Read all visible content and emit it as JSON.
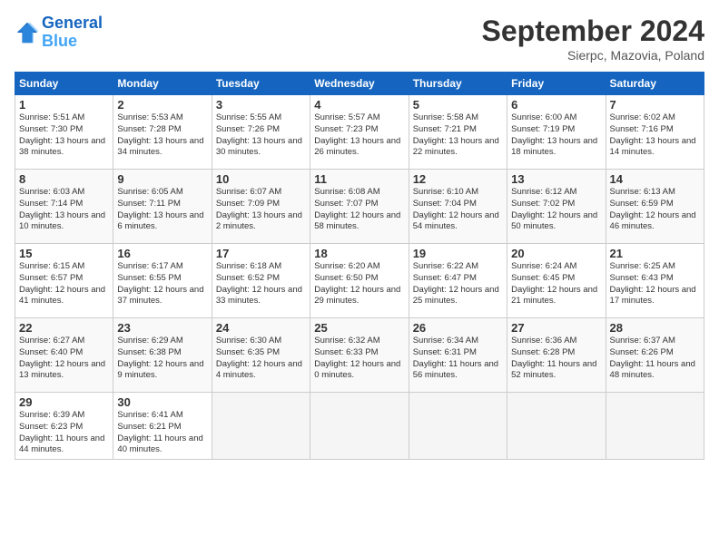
{
  "header": {
    "logo_line1": "General",
    "logo_line2": "Blue",
    "month_title": "September 2024",
    "location": "Sierpc, Mazovia, Poland"
  },
  "days_of_week": [
    "Sunday",
    "Monday",
    "Tuesday",
    "Wednesday",
    "Thursday",
    "Friday",
    "Saturday"
  ],
  "weeks": [
    [
      {
        "day": "1",
        "sunrise": "5:51 AM",
        "sunset": "7:30 PM",
        "daylight": "13 hours and 38 minutes."
      },
      {
        "day": "2",
        "sunrise": "5:53 AM",
        "sunset": "7:28 PM",
        "daylight": "13 hours and 34 minutes."
      },
      {
        "day": "3",
        "sunrise": "5:55 AM",
        "sunset": "7:26 PM",
        "daylight": "13 hours and 30 minutes."
      },
      {
        "day": "4",
        "sunrise": "5:57 AM",
        "sunset": "7:23 PM",
        "daylight": "13 hours and 26 minutes."
      },
      {
        "day": "5",
        "sunrise": "5:58 AM",
        "sunset": "7:21 PM",
        "daylight": "13 hours and 22 minutes."
      },
      {
        "day": "6",
        "sunrise": "6:00 AM",
        "sunset": "7:19 PM",
        "daylight": "13 hours and 18 minutes."
      },
      {
        "day": "7",
        "sunrise": "6:02 AM",
        "sunset": "7:16 PM",
        "daylight": "13 hours and 14 minutes."
      }
    ],
    [
      {
        "day": "8",
        "sunrise": "6:03 AM",
        "sunset": "7:14 PM",
        "daylight": "13 hours and 10 minutes."
      },
      {
        "day": "9",
        "sunrise": "6:05 AM",
        "sunset": "7:11 PM",
        "daylight": "13 hours and 6 minutes."
      },
      {
        "day": "10",
        "sunrise": "6:07 AM",
        "sunset": "7:09 PM",
        "daylight": "13 hours and 2 minutes."
      },
      {
        "day": "11",
        "sunrise": "6:08 AM",
        "sunset": "7:07 PM",
        "daylight": "12 hours and 58 minutes."
      },
      {
        "day": "12",
        "sunrise": "6:10 AM",
        "sunset": "7:04 PM",
        "daylight": "12 hours and 54 minutes."
      },
      {
        "day": "13",
        "sunrise": "6:12 AM",
        "sunset": "7:02 PM",
        "daylight": "12 hours and 50 minutes."
      },
      {
        "day": "14",
        "sunrise": "6:13 AM",
        "sunset": "6:59 PM",
        "daylight": "12 hours and 46 minutes."
      }
    ],
    [
      {
        "day": "15",
        "sunrise": "6:15 AM",
        "sunset": "6:57 PM",
        "daylight": "12 hours and 41 minutes."
      },
      {
        "day": "16",
        "sunrise": "6:17 AM",
        "sunset": "6:55 PM",
        "daylight": "12 hours and 37 minutes."
      },
      {
        "day": "17",
        "sunrise": "6:18 AM",
        "sunset": "6:52 PM",
        "daylight": "12 hours and 33 minutes."
      },
      {
        "day": "18",
        "sunrise": "6:20 AM",
        "sunset": "6:50 PM",
        "daylight": "12 hours and 29 minutes."
      },
      {
        "day": "19",
        "sunrise": "6:22 AM",
        "sunset": "6:47 PM",
        "daylight": "12 hours and 25 minutes."
      },
      {
        "day": "20",
        "sunrise": "6:24 AM",
        "sunset": "6:45 PM",
        "daylight": "12 hours and 21 minutes."
      },
      {
        "day": "21",
        "sunrise": "6:25 AM",
        "sunset": "6:43 PM",
        "daylight": "12 hours and 17 minutes."
      }
    ],
    [
      {
        "day": "22",
        "sunrise": "6:27 AM",
        "sunset": "6:40 PM",
        "daylight": "12 hours and 13 minutes."
      },
      {
        "day": "23",
        "sunrise": "6:29 AM",
        "sunset": "6:38 PM",
        "daylight": "12 hours and 9 minutes."
      },
      {
        "day": "24",
        "sunrise": "6:30 AM",
        "sunset": "6:35 PM",
        "daylight": "12 hours and 4 minutes."
      },
      {
        "day": "25",
        "sunrise": "6:32 AM",
        "sunset": "6:33 PM",
        "daylight": "12 hours and 0 minutes."
      },
      {
        "day": "26",
        "sunrise": "6:34 AM",
        "sunset": "6:31 PM",
        "daylight": "11 hours and 56 minutes."
      },
      {
        "day": "27",
        "sunrise": "6:36 AM",
        "sunset": "6:28 PM",
        "daylight": "11 hours and 52 minutes."
      },
      {
        "day": "28",
        "sunrise": "6:37 AM",
        "sunset": "6:26 PM",
        "daylight": "11 hours and 48 minutes."
      }
    ],
    [
      {
        "day": "29",
        "sunrise": "6:39 AM",
        "sunset": "6:23 PM",
        "daylight": "11 hours and 44 minutes."
      },
      {
        "day": "30",
        "sunrise": "6:41 AM",
        "sunset": "6:21 PM",
        "daylight": "11 hours and 40 minutes."
      },
      null,
      null,
      null,
      null,
      null
    ]
  ]
}
